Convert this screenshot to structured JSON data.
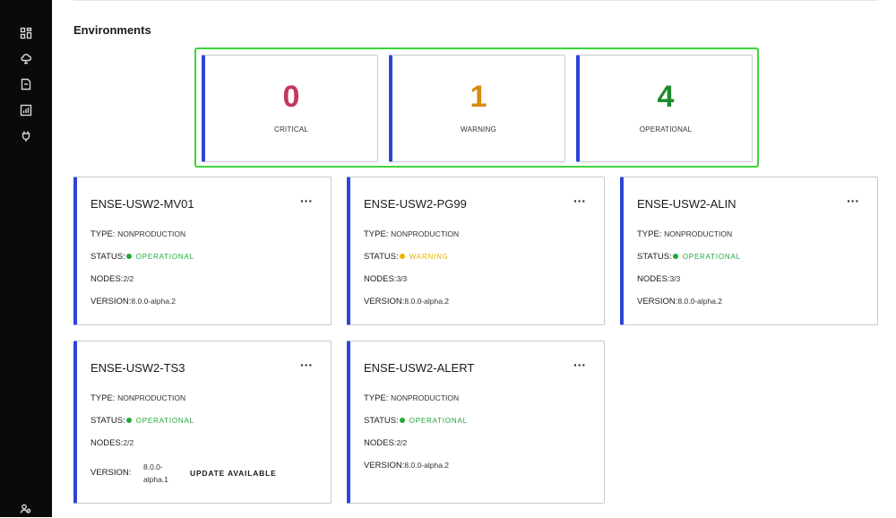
{
  "sidebar": {
    "icons": [
      "dashboard-icon",
      "cloud-icon",
      "document-icon",
      "chart-icon",
      "plug-icon",
      "users-icon"
    ]
  },
  "page": {
    "title": "Environments"
  },
  "summary": [
    {
      "count": "0",
      "label": "CRITICAL",
      "color": "#c4365c"
    },
    {
      "count": "1",
      "label": "WARNING",
      "color": "#d98a10"
    },
    {
      "count": "4",
      "label": "OPERATIONAL",
      "color": "#1e8a2e"
    }
  ],
  "labels": {
    "type": "TYPE:",
    "status": "STATUS:",
    "nodes": "NODES:",
    "version": "VERSION:",
    "menu": "···"
  },
  "status_colors": {
    "OPERATIONAL": "#22a83a",
    "WARNING": "#e8b400"
  },
  "environments": [
    {
      "name": "ENSE-USW2-MV01",
      "type": "NONPRODUCTION",
      "status": "OPERATIONAL",
      "nodes": "2/2",
      "version": "8.0.0-alpha.2"
    },
    {
      "name": "ENSE-USW2-PG99",
      "type": "NONPRODUCTION",
      "status": "WARNING",
      "nodes": "3/3",
      "version": "8.0.0-alpha.2"
    },
    {
      "name": "ENSE-USW2-ALIN",
      "type": "NONPRODUCTION",
      "status": "OPERATIONAL",
      "nodes": "3/3",
      "version": "8.0.0-alpha.2"
    },
    {
      "name": "ENSE-USW2-TS3",
      "type": "NONPRODUCTION",
      "status": "OPERATIONAL",
      "nodes": "2/2",
      "version_line1": "8.0.0-",
      "version_line2": "alpha.1",
      "update_label": "UPDATE AVAILABLE"
    },
    {
      "name": "ENSE-USW2-ALERT",
      "type": "NONPRODUCTION",
      "status": "OPERATIONAL",
      "nodes": "2/2",
      "version": "8.0.0-alpha.2"
    }
  ]
}
